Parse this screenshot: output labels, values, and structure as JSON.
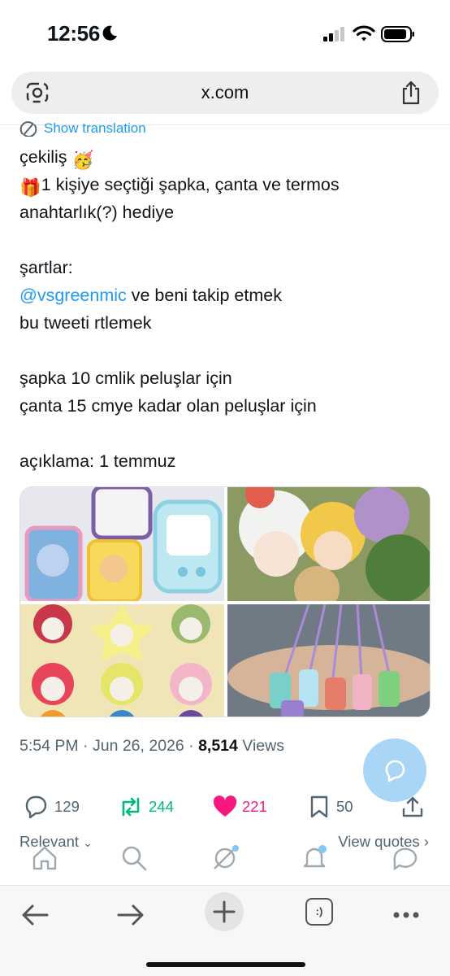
{
  "status_bar": {
    "time": "12:56"
  },
  "browser": {
    "url": "x.com",
    "tabs_label": ":)"
  },
  "tweet": {
    "translate_label": "Show translation",
    "lines": [
      {
        "text": "çekiliş",
        "emoji": "🥳"
      },
      {
        "emoji": "🎁",
        "text": "1 kişiye seçtiği şapka, çanta ve termos"
      },
      {
        "text": "anahtarlık(?) hediye"
      },
      {
        "text": ""
      },
      {
        "text": "şartlar:"
      },
      {
        "mention": "@vsgreenmic",
        "text": " ve beni takip etmek"
      },
      {
        "text": "bu tweeti rtlemek"
      },
      {
        "text": ""
      },
      {
        "text": "şapka 10 cmlik peluşlar için"
      },
      {
        "text": "çanta 15 cmye kadar olan peluşlar için"
      },
      {
        "text": ""
      },
      {
        "text": "açıklama: 1 temmuz"
      }
    ],
    "meta": {
      "time": "5:54 PM",
      "sep": " · ",
      "date": "Jun 26, 2026",
      "views_count": "8,514",
      "views_label": " Views"
    }
  },
  "actions": {
    "replies": "129",
    "reposts": "244",
    "likes": "221",
    "bookmarks": "50"
  },
  "replies_header": {
    "sort_label": "Relevant",
    "view_quotes": "View quotes"
  },
  "colors": {
    "accent": "#1d9bf0",
    "repost": "#00ba7c",
    "like": "#f91880",
    "muted": "#536471"
  }
}
